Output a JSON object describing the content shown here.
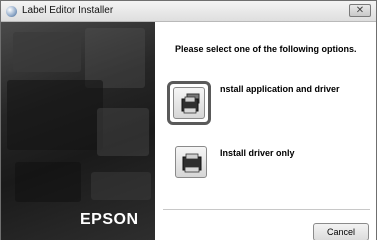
{
  "window": {
    "title": "Label Editor Installer",
    "close_label": "✕"
  },
  "sidebar": {
    "brand": "EPSON"
  },
  "main": {
    "prompt": "Please select one of the following options.",
    "options": [
      {
        "label": "nstall application and driver",
        "icon": "printer-app-icon",
        "selected": true
      },
      {
        "label": "Install driver only",
        "icon": "printer-icon",
        "selected": false
      }
    ]
  },
  "footer": {
    "cancel_label": "Cancel"
  }
}
